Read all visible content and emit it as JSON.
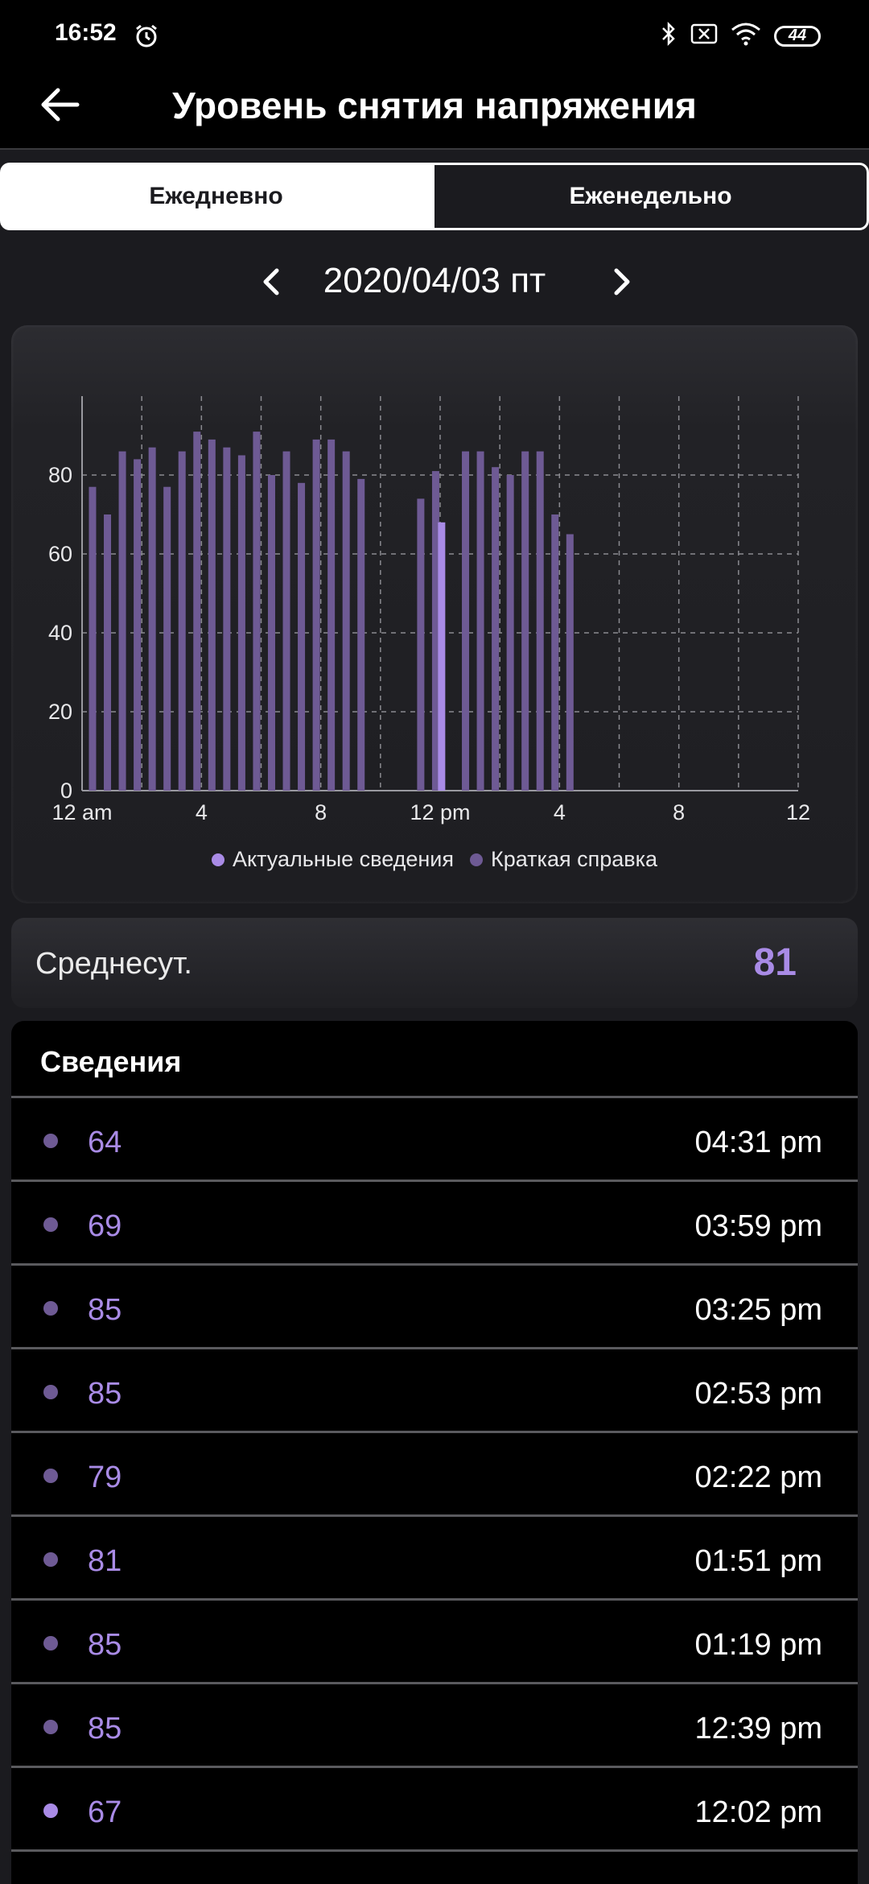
{
  "status_bar": {
    "time": "16:52",
    "battery": "44"
  },
  "header": {
    "title": "Уровень снятия напряжения"
  },
  "tabs": [
    {
      "label": "Ежедневно",
      "active": true
    },
    {
      "label": "Еженедельно",
      "active": false
    }
  ],
  "date_nav": {
    "date": "2020/04/03 пт"
  },
  "colors": {
    "accent": "#a98be6",
    "summary": "#6e5a94"
  },
  "chart_data": {
    "type": "bar",
    "x_unit": "hour of day",
    "xlim": [
      0,
      24
    ],
    "ylim": [
      0,
      100
    ],
    "y_ticks": [
      0,
      20,
      40,
      60,
      80
    ],
    "x_ticks": [
      {
        "x": 0,
        "label": "12 am"
      },
      {
        "x": 4,
        "label": "4"
      },
      {
        "x": 8,
        "label": "8"
      },
      {
        "x": 12,
        "label": "12 pm"
      },
      {
        "x": 16,
        "label": "4"
      },
      {
        "x": 20,
        "label": "8"
      },
      {
        "x": 24,
        "label": "12"
      }
    ],
    "series": [
      {
        "name": "Краткая справка",
        "color": "#6e5a94",
        "x": [
          0.35,
          0.85,
          1.35,
          1.85,
          2.35,
          2.85,
          3.35,
          3.85,
          4.35,
          4.85,
          5.35,
          5.85,
          6.35,
          6.85,
          7.35,
          7.85,
          8.35,
          8.85,
          9.35,
          11.35,
          11.85,
          12.85,
          13.35,
          13.85,
          14.35,
          14.85,
          15.35,
          15.85,
          16.35
        ],
        "values": [
          77,
          70,
          86,
          84,
          87,
          77,
          86,
          91,
          89,
          87,
          85,
          91,
          80,
          86,
          78,
          89,
          89,
          86,
          79,
          74,
          81,
          86,
          86,
          82,
          80,
          86,
          86,
          70,
          65
        ]
      },
      {
        "name": "Актуальные сведения",
        "color": "#a98be6",
        "x": [
          12.05
        ],
        "values": [
          68
        ]
      }
    ],
    "legend": [
      "Актуальные сведения",
      "Краткая справка"
    ],
    "legend_position": "bottom"
  },
  "average": {
    "label": "Среднесут.",
    "value": "81"
  },
  "details": {
    "title": "Сведения",
    "rows": [
      {
        "value": "64",
        "time": "04:31 pm",
        "dot": "#6e5a94"
      },
      {
        "value": "69",
        "time": "03:59 pm",
        "dot": "#6e5a94"
      },
      {
        "value": "85",
        "time": "03:25 pm",
        "dot": "#6e5a94"
      },
      {
        "value": "85",
        "time": "02:53 pm",
        "dot": "#6e5a94"
      },
      {
        "value": "79",
        "time": "02:22 pm",
        "dot": "#6e5a94"
      },
      {
        "value": "81",
        "time": "01:51 pm",
        "dot": "#6e5a94"
      },
      {
        "value": "85",
        "time": "01:19 pm",
        "dot": "#6e5a94"
      },
      {
        "value": "85",
        "time": "12:39 pm",
        "dot": "#6e5a94"
      },
      {
        "value": "67",
        "time": "12:02 pm",
        "dot": "#a98be6"
      }
    ]
  }
}
